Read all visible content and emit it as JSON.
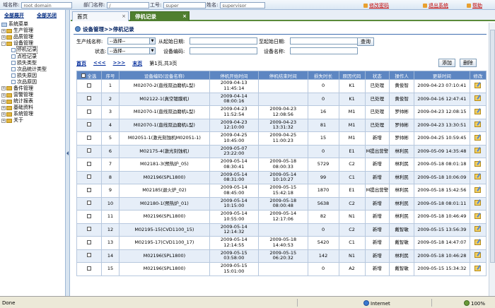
{
  "topbar": {
    "domain_label": "域名称:",
    "domain_value": "root domain",
    "dept_label": "部门名称:",
    "dept_value": "/",
    "emp_label": "工号:",
    "emp_value": "super",
    "name_label": "姓名:",
    "name_value": "supervisor",
    "change_pwd": "修改密码",
    "logout": "退出系统",
    "help": "帮助"
  },
  "leftnav": {
    "expand_all": "全部展开",
    "collapse_all": "全部关闭",
    "root": "系统菜单",
    "items": [
      {
        "label": "生产管理",
        "level": 1,
        "pm": "+"
      },
      {
        "label": "品质管理",
        "level": 1,
        "pm": "+"
      },
      {
        "label": "设备管理",
        "level": 1,
        "pm": "-"
      },
      {
        "label": "停机记录",
        "level": 2,
        "selected": true
      },
      {
        "label": "点检记录",
        "level": 2
      },
      {
        "label": "损失类型",
        "level": 2
      },
      {
        "label": "次品统计类型",
        "level": 2
      },
      {
        "label": "损失原因",
        "level": 2
      },
      {
        "label": "次品原因",
        "level": 2
      },
      {
        "label": "备件管理",
        "level": 1,
        "pm": "+"
      },
      {
        "label": "营警管理",
        "level": 1,
        "pm": "+"
      },
      {
        "label": "统计报表",
        "level": 1,
        "pm": "+"
      },
      {
        "label": "基础资料",
        "level": 1,
        "pm": "+"
      },
      {
        "label": "系统管理",
        "level": 1,
        "pm": "+"
      },
      {
        "label": "关于",
        "level": 1,
        "pm": "+"
      }
    ]
  },
  "tabs": [
    {
      "label": "首页",
      "active": false
    },
    {
      "label": "停机记录",
      "active": true
    }
  ],
  "content": {
    "breadcrumb": "设备管理>>停机记录",
    "filter": {
      "line_label": "生产线名称:",
      "line_value": "--选择--",
      "start_label": "从起始日期:",
      "start_value": "",
      "end_label": "至起始日期:",
      "end_value": "",
      "query_btn": "查询",
      "status_label": "状态:",
      "status_value": "--选择--",
      "code_label": "设备编码:",
      "code_value": "",
      "name_label": "设备名称:",
      "name_value": ""
    },
    "add_btn": "添加",
    "delete_btn": "删除",
    "pager": {
      "first": "首页",
      "prev": "<<<",
      "next": ">>>",
      "last": "末页",
      "info": "第1页,共3页"
    },
    "columns": [
      "全选",
      "序号",
      "设备编码(设备名称)",
      "停机开始时间",
      "停机结束时间",
      "损失时长",
      "原因代码",
      "状态",
      "操作人",
      "更新时间",
      "修改"
    ],
    "rows": [
      {
        "no": "1",
        "equip": "M02070-2(直线双边磨机L型)",
        "start": "2009-04-13 11:45:14",
        "end": "",
        "loss": "0",
        "code": "K1",
        "status": "已处理",
        "op": "黄俊智",
        "updated": "2009-04-23 07:10:41"
      },
      {
        "no": "2",
        "equip": "M02122-1(真空镀膜机)",
        "start": "2009-04-14 08:00:16",
        "end": "",
        "loss": "0",
        "code": "K1",
        "status": "已处理",
        "op": "黄俊智",
        "updated": "2009-04-16 12:47:41"
      },
      {
        "no": "3",
        "equip": "M02070-1(直线双边磨机L型)",
        "start": "2009-04-23 11:52:54",
        "end": "2009-04-23 12:08:56",
        "loss": "16",
        "code": "M1",
        "status": "已处理",
        "op": "罗帅彬",
        "updated": "2009-04-23 12:08:15"
      },
      {
        "no": "4",
        "equip": "M02070-1(直线双边磨机L型)",
        "start": "2009-04-23 12:10:00",
        "end": "2009-04-23 13:31:32",
        "loss": "81",
        "code": "M1",
        "status": "已处理",
        "op": "罗帅彬",
        "updated": "2009-04-23 13:30:51"
      },
      {
        "no": "5",
        "equip": "M02051-1(激光刻蚀机M02051-1)",
        "start": "2009-04-25 10:45:00",
        "end": "2009-04-25 11:00:23",
        "loss": "15",
        "code": "M1",
        "status": "新增",
        "op": "罗帅彬",
        "updated": "2009-04-25 10:59:45"
      },
      {
        "no": "6",
        "equip": "M02175-4(激光刻蚀机)",
        "start": "2009-05-07 23:22:00",
        "end": "",
        "loss": "0",
        "code": "E1",
        "status": "M提出营警",
        "op": "林利民",
        "updated": "2009-05-09 14:35:48"
      },
      {
        "no": "7",
        "equip": "M02181-3(预热炉_05)",
        "start": "2009-05-14 08:30:41",
        "end": "2009-05-18 08:00:33",
        "loss": "5729",
        "code": "C2",
        "status": "新增",
        "op": "林利民",
        "updated": "2009-05-18 08:01:18"
      },
      {
        "no": "8",
        "equip": "M02196(SPL1800)",
        "start": "2009-05-14 08:31:00",
        "end": "2009-05-14 10:10:27",
        "loss": "99",
        "code": "C1",
        "status": "新增",
        "op": "林利民",
        "updated": "2009-05-18 10:06:09"
      },
      {
        "no": "9",
        "equip": "M02185(退火炉_02)",
        "start": "2009-05-14 08:45:00",
        "end": "2009-05-15 15:42:18",
        "loss": "1870",
        "code": "E1",
        "status": "M提出营警",
        "op": "林利民",
        "updated": "2009-05-18 15:42:56"
      },
      {
        "no": "10",
        "equip": "M02180-1(预热炉_01)",
        "start": "2009-05-14 10:15:00",
        "end": "2009-05-18 08:00:48",
        "loss": "5638",
        "code": "C2",
        "status": "新增",
        "op": "林利民",
        "updated": "2009-05-18 08:01:11"
      },
      {
        "no": "11",
        "equip": "M02196(SPL1800)",
        "start": "2009-05-14 10:55:00",
        "end": "2009-05-14 12:17:06",
        "loss": "82",
        "code": "N1",
        "status": "新增",
        "op": "林利民",
        "updated": "2009-05-18 10:46:49"
      },
      {
        "no": "12",
        "equip": "M02195-15(CVD1100_15)",
        "start": "2009-05-14 12:14:32",
        "end": "",
        "loss": "0",
        "code": "C2",
        "status": "新增",
        "op": "戴智敏",
        "updated": "2009-05-15 13:56:39"
      },
      {
        "no": "13",
        "equip": "M02195-17(CVD1100_17)",
        "start": "2009-05-14 12:14:55",
        "end": "2009-05-18 14:40:53",
        "loss": "5420",
        "code": "C1",
        "status": "新增",
        "op": "戴智敏",
        "updated": "2009-05-18 14:47:07"
      },
      {
        "no": "14",
        "equip": "M02196(SPL1800)",
        "start": "2009-05-15 03:58:00",
        "end": "2009-05-15 06:20:32",
        "loss": "142",
        "code": "N1",
        "status": "新增",
        "op": "林利民",
        "updated": "2009-05-18 10:46:28"
      },
      {
        "no": "15",
        "equip": "M02196(SPL1800)",
        "start": "2009-05-15 15:01:00",
        "end": "",
        "loss": "0",
        "code": "A2",
        "status": "新增",
        "op": "戴智敏",
        "updated": "2009-05-15 15:34:32"
      }
    ]
  },
  "statusbar": {
    "left": "Done",
    "zone": "Internet",
    "zoom": "100%"
  }
}
